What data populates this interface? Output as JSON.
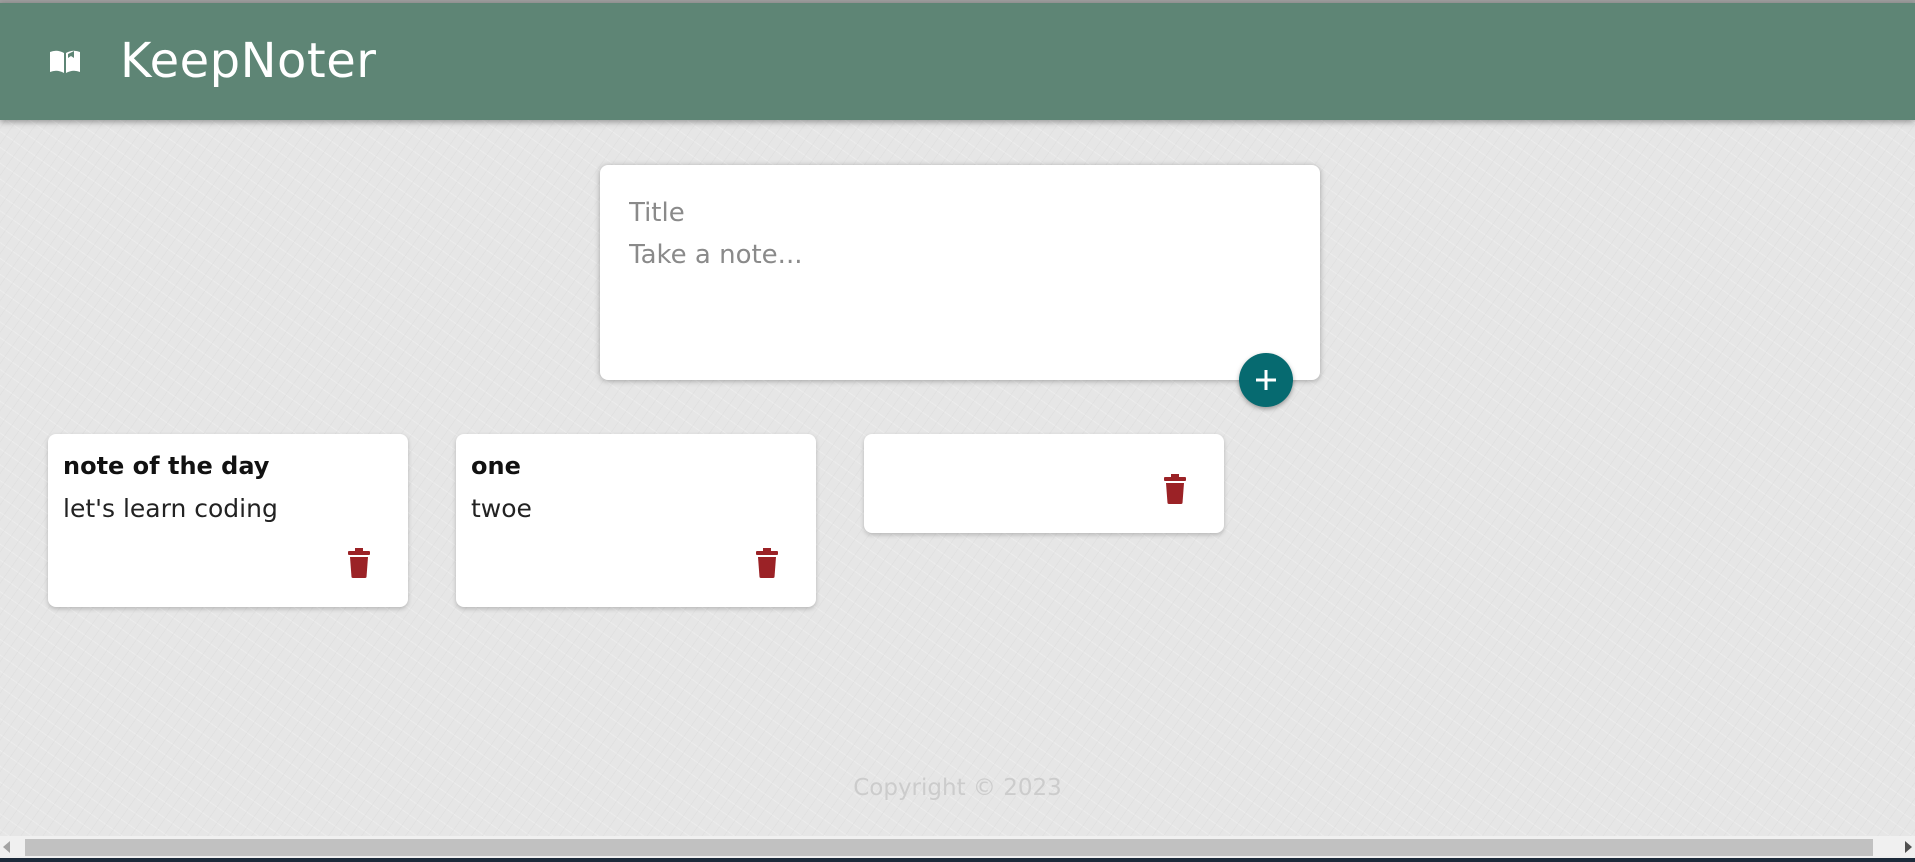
{
  "app": {
    "title": "KeepNoter",
    "logo_icon": "book-open-icon",
    "header_color": "#5e8575"
  },
  "create_note": {
    "title_placeholder": "Title",
    "content_placeholder": "Take a note...",
    "add_icon": "plus-icon",
    "add_button_color": "#066a70"
  },
  "notes": [
    {
      "title": "note of the day",
      "content": "let's learn coding",
      "delete_icon": "trash-icon"
    },
    {
      "title": "one",
      "content": "twoe",
      "delete_icon": "trash-icon"
    },
    {
      "title": "",
      "content": "",
      "delete_icon": "trash-icon"
    }
  ],
  "delete_icon_color": "#9b2226",
  "footer": {
    "text": "Copyright © 2023"
  }
}
